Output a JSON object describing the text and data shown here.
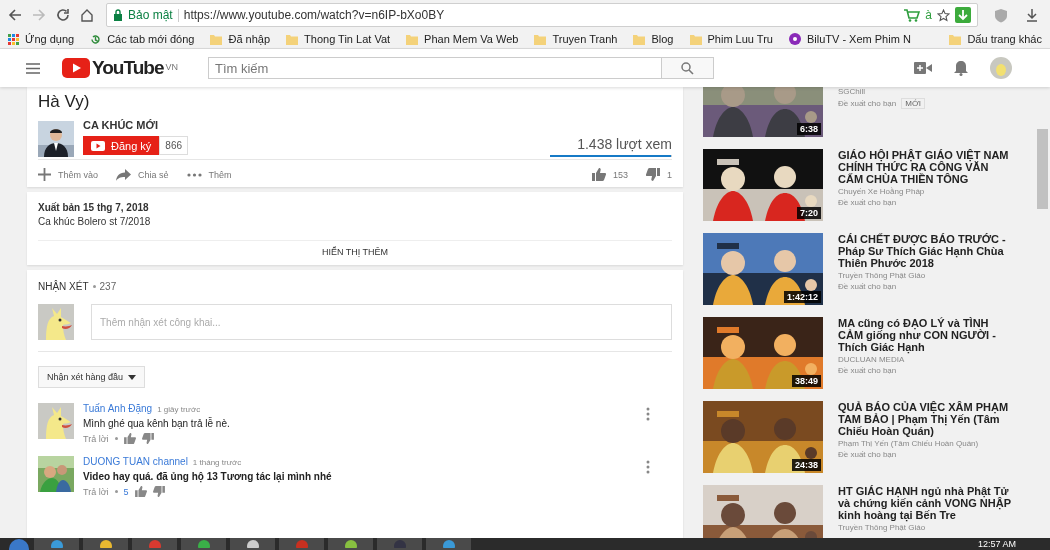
{
  "browser": {
    "security_label": "Bảo mật",
    "url": "https://www.youtube.com/watch?v=n6IP-bXo0BY",
    "extension_badge": "à"
  },
  "bookmarks": [
    {
      "label": "Ứng dụng",
      "kind": "apps"
    },
    {
      "label": "Các tab mới đóng",
      "kind": "history"
    },
    {
      "label": "Đã nhập",
      "kind": "folder"
    },
    {
      "label": "Thong Tin Lat Vat",
      "kind": "folder"
    },
    {
      "label": "Phan Mem Va Web",
      "kind": "folder"
    },
    {
      "label": "Truyen Tranh",
      "kind": "folder"
    },
    {
      "label": "Blog",
      "kind": "folder"
    },
    {
      "label": "Phim Luu Tru",
      "kind": "folder"
    },
    {
      "label": "BiluTV - Xem Phim N",
      "kind": "site"
    }
  ],
  "other_bookmarks": "Dấu trang khác",
  "header": {
    "logo": "YouTube",
    "region": "VN",
    "search_placeholder": "Tìm kiếm"
  },
  "video": {
    "title": "Hà Vy)",
    "channel": "CA KHÚC MỚI",
    "subscribe": "Đăng ký",
    "subscribers": "866",
    "views": "1.438 lượt xem",
    "like_bar": {
      "level": 0.99
    },
    "actions": [
      {
        "label": "Thêm vào",
        "kind": "add"
      },
      {
        "label": "Chia sẻ",
        "kind": "share"
      },
      {
        "label": "Thêm",
        "kind": "more"
      }
    ],
    "likes": "153",
    "dislikes": "1"
  },
  "description": {
    "published": "Xuất bản 15 thg 7, 2018",
    "text": "Ca khúc Bolero st 7/2018",
    "show_more": "HIỂN THỊ THÊM"
  },
  "comments": {
    "heading": "NHẬN XÉT",
    "count": "237",
    "placeholder": "Thêm nhận xét công khai...",
    "sort": "Nhận xét hàng đầu",
    "items": [
      {
        "author": "Tuấn Anh Đặng",
        "time": "1 giây trước",
        "text": "Mình ghé qua kênh bạn trả lễ nè.",
        "reply": "Trả lời"
      },
      {
        "author": "DUONG TUAN channel",
        "time": "1 tháng trước",
        "text": "Video hay quá. đã ủng hộ 13 Tương tác lại mình nhé",
        "reply": "Trả lời",
        "likes": "5"
      }
    ]
  },
  "recommended": [
    {
      "channel": "SGChill",
      "reason": "Đề xuất cho bạn",
      "badge": "MỚI",
      "duration": "6:38"
    },
    {
      "title": "GIÁO HỘI PHẬT GIÁO VIỆT NAM CHÍNH THỨC RA CÔNG VĂN CẤM CHÙA THIỀN TÔNG",
      "channel": "Chuyến Xe Hoằng Pháp",
      "reason": "Đề xuất cho bạn",
      "duration": "7:20"
    },
    {
      "title": "CÁI CHẾT ĐƯỢC BÁO TRƯỚC - Pháp Sư Thích Giác Hạnh Chùa Thiên Phước 2018",
      "channel": "Truyền Thông Phật Giáo",
      "reason": "Đề xuất cho bạn",
      "duration": "1:42:12"
    },
    {
      "title": "MA cũng có ĐẠO LÝ và TÌNH CẢM giống như CON NGƯỜI - Thích Giác Hạnh",
      "channel": "DUCLUAN MEDIA",
      "reason": "Đề xuất cho bạn",
      "duration": "38:49"
    },
    {
      "title": "QUẢ BÁO CỦA VIỆC XÂM PHẠM TAM BẢO | Phạm Thị Yến (Tâm Chiếu Hoàn Quán)",
      "channel": "Phạm Thị Yến (Tâm Chiếu Hoàn Quán)",
      "reason": "Đề xuất cho bạn",
      "duration": "24:38"
    },
    {
      "title": "HT GIÁC HẠNH ngủ nhà Phật Tử và chứng kiến cảnh VONG NHẬP kinh hoàng tại Bến Tre",
      "channel": "Truyền Thông Phật Giáo"
    }
  ],
  "taskbar": {
    "clock": "12:57 AM"
  }
}
